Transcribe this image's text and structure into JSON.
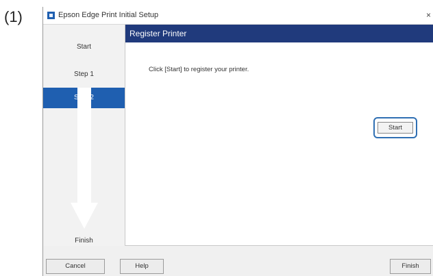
{
  "figure_label": "(1)",
  "window": {
    "title": "Epson Edge Print Initial Setup",
    "close_glyph": "×"
  },
  "sidebar": {
    "steps": [
      {
        "label": "Start",
        "active": false
      },
      {
        "label": "Step 1",
        "active": false
      },
      {
        "label": "Step 2",
        "active": true
      },
      {
        "label": "Finish",
        "active": false
      }
    ]
  },
  "main": {
    "header_title": "Register Printer",
    "instruction": "Click [Start] to register your printer.",
    "start_button": "Start"
  },
  "footer": {
    "cancel": "Cancel",
    "help": "Help",
    "finish": "Finish"
  },
  "colors": {
    "header": "#203a7c",
    "active_step": "#1f5fb0",
    "highlight": "#2f6fb3"
  }
}
